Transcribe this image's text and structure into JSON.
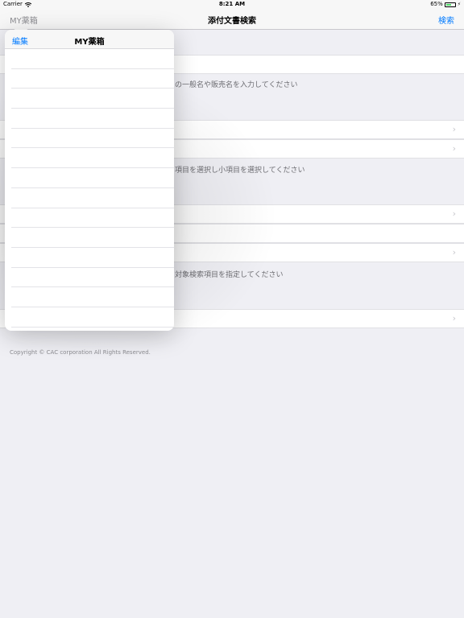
{
  "status": {
    "carrier": "Carrier",
    "time": "8:21 AM",
    "battery": "65%",
    "battery_level": 0.65
  },
  "nav": {
    "left": "MY薬箱",
    "title": "添付文書検索",
    "right": "検索"
  },
  "sections": [
    {
      "footer": "の一般名や販売名を入力してください"
    },
    {
      "footer": "項目を選択し小項目を選択してください"
    },
    {
      "footer": "対象検索項目を指定してください"
    }
  ],
  "copyright": "Copyright © CAC corporation All Rights Reserved.",
  "popover": {
    "edit": "編集",
    "title": "MY薬箱",
    "row_count": 14
  },
  "icons": {
    "wifi": "wifi-icon",
    "chevron": "chevron-right-icon",
    "battery": "battery-icon"
  },
  "colors": {
    "accent": "#007aff",
    "battery": "#4cd964",
    "background": "#efeff4"
  }
}
